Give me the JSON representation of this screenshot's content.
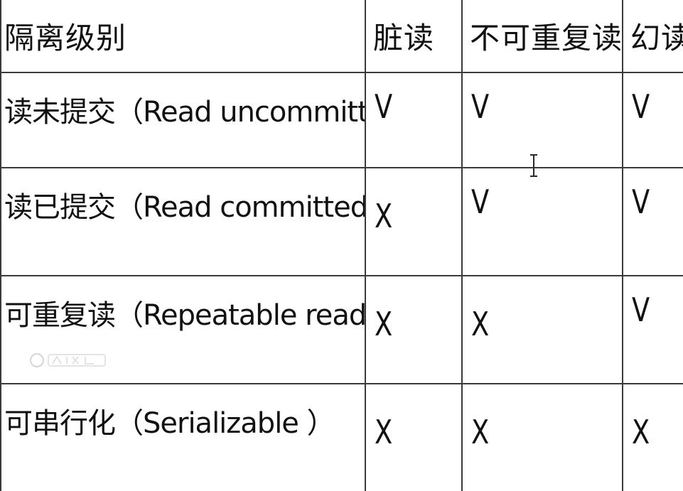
{
  "table": {
    "headers": {
      "level": "隔离级别",
      "dirty_read": "脏读",
      "non_repeatable_read": "不可重复读",
      "phantom_read": "幻读"
    },
    "rows": [
      {
        "level": "读未提交（Read uncommitted）",
        "dirty_read": "V",
        "non_repeatable_read": "V",
        "phantom_read": "V"
      },
      {
        "level": "读已提交（Read committed）",
        "dirty_read": "X",
        "non_repeatable_read": "V",
        "phantom_read": "V"
      },
      {
        "level": "可重复读（Repeatable read）",
        "dirty_read": "X",
        "non_repeatable_read": "X",
        "phantom_read": "V"
      },
      {
        "level": "可串行化（Serializable ）",
        "dirty_read": "X",
        "non_repeatable_read": "X",
        "phantom_read": "X"
      }
    ]
  },
  "overlay": {
    "cursor_icon": "text-cursor-icon",
    "watermark_icon": "baidu-watermark-icon"
  },
  "colors": {
    "text": "#111111",
    "grid": "#3a3a3a",
    "background": "#ffffff"
  }
}
